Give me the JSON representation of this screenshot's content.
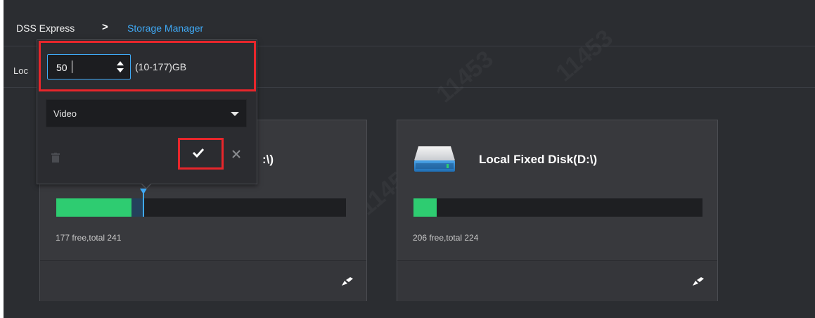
{
  "breadcrumb": {
    "root": "DSS Express",
    "separator": ">",
    "current": "Storage Manager"
  },
  "toolbar": {
    "label": "Loc"
  },
  "popup": {
    "size_value": "50",
    "range_text": "(10-177)GB",
    "type_selected": "Video"
  },
  "disks": [
    {
      "title_partial": ":\\)",
      "icon": "hard-disk-icon",
      "used_fraction": 0.26,
      "allocated_fraction": 0.04,
      "marker_fraction": 0.3,
      "free_text": "177 free,total 241"
    },
    {
      "title": "Local Fixed Disk(D:\\)",
      "icon": "hard-disk-icon",
      "used_fraction": 0.08,
      "free_text": "206 free,total 224"
    }
  ],
  "colors": {
    "background": "#2b2d31",
    "accent": "#3fa9f5",
    "used": "#2ecc71",
    "highlight": "#e8262b"
  }
}
